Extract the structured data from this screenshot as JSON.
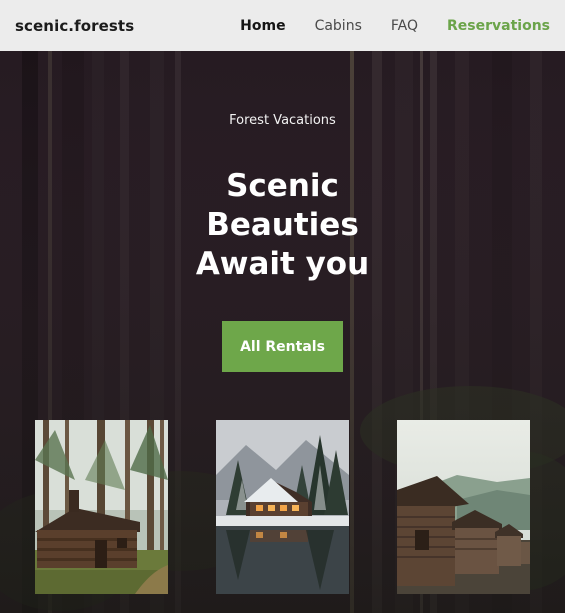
{
  "header": {
    "brand": "scenic.forests",
    "nav": [
      {
        "label": "Home",
        "active": true
      },
      {
        "label": "Cabins",
        "active": false
      },
      {
        "label": "FAQ",
        "active": false
      },
      {
        "label": "Reservations",
        "active": false
      }
    ]
  },
  "hero": {
    "eyebrow": "Forest Vacations",
    "headline_lines": [
      "Scenic",
      "Beauties",
      "Await you"
    ],
    "cta_label": "All Rentals"
  },
  "gallery": [
    {
      "icon": "forest-cabin-photo"
    },
    {
      "icon": "snowy-cabin-lake-photo"
    },
    {
      "icon": "old-wooden-cabins-photo"
    }
  ],
  "colors": {
    "accent": "#6ea74a",
    "header_bg": "#ececec",
    "hero_bg": "#241a20"
  }
}
